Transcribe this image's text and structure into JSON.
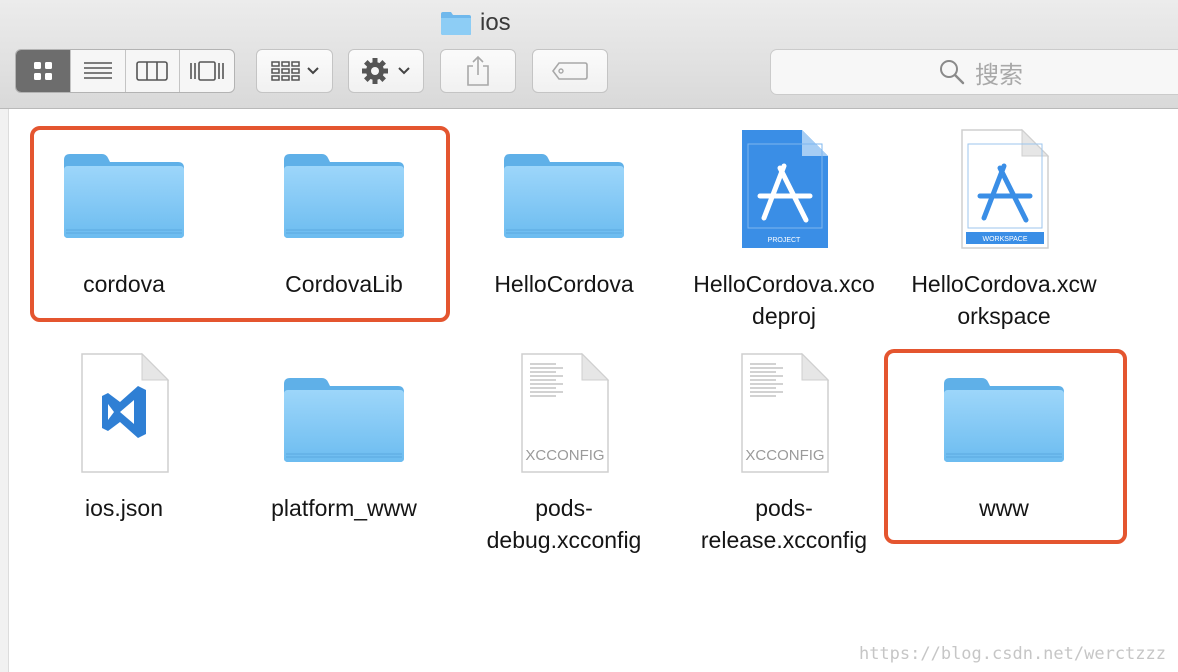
{
  "window": {
    "title": "ios"
  },
  "toolbar": {
    "view_modes": [
      "icon-view",
      "list-view",
      "column-view",
      "cover-flow-view"
    ],
    "active_view": "icon-view",
    "arrange_icon": "grid-arrange-icon",
    "action_icon": "gear-icon",
    "share_icon": "share-icon",
    "tag_icon": "tag-icon"
  },
  "search": {
    "placeholder": "搜索"
  },
  "files": [
    {
      "name": "cordova",
      "kind": "folder"
    },
    {
      "name": "CordovaLib",
      "kind": "folder"
    },
    {
      "name": "HelloCordova",
      "kind": "folder"
    },
    {
      "name": "HelloCordova.xco\ndeproj",
      "kind": "xcodeproj",
      "badge": "PROJECT"
    },
    {
      "name": "HelloCordova.xcw\norkspace",
      "kind": "xcworkspace",
      "badge": "WORKSPACE"
    },
    {
      "name": "ios.json",
      "kind": "vscode-json"
    },
    {
      "name": "platform_www",
      "kind": "folder"
    },
    {
      "name": "pods-\ndebug.xcconfig",
      "kind": "xcconfig",
      "badge": "XCCONFIG"
    },
    {
      "name": "pods-\nrelease.xcconfig",
      "kind": "xcconfig",
      "badge": "XCCONFIG"
    },
    {
      "name": "www",
      "kind": "folder"
    }
  ],
  "colors": {
    "folder": "#7cc4f2",
    "highlight": "#e4552f",
    "xcode_blue": "#3a8ee6"
  },
  "watermark": "https://blog.csdn.net/werctzzz"
}
